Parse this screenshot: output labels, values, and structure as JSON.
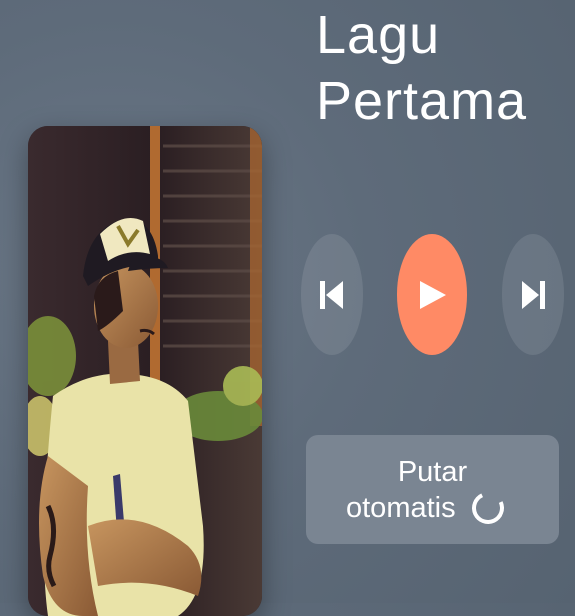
{
  "song": {
    "title": "Lagu Pertama"
  },
  "controls": {
    "previous_icon": "skip-previous-icon",
    "play_icon": "play-icon",
    "next_icon": "skip-next-icon",
    "play_color": "#ff8a65"
  },
  "autoplay": {
    "label_line1": "Putar",
    "label_line2": "otomatis",
    "icon": "loading-spinner-icon"
  },
  "album_art": {
    "description_icon": "album-art-image"
  }
}
